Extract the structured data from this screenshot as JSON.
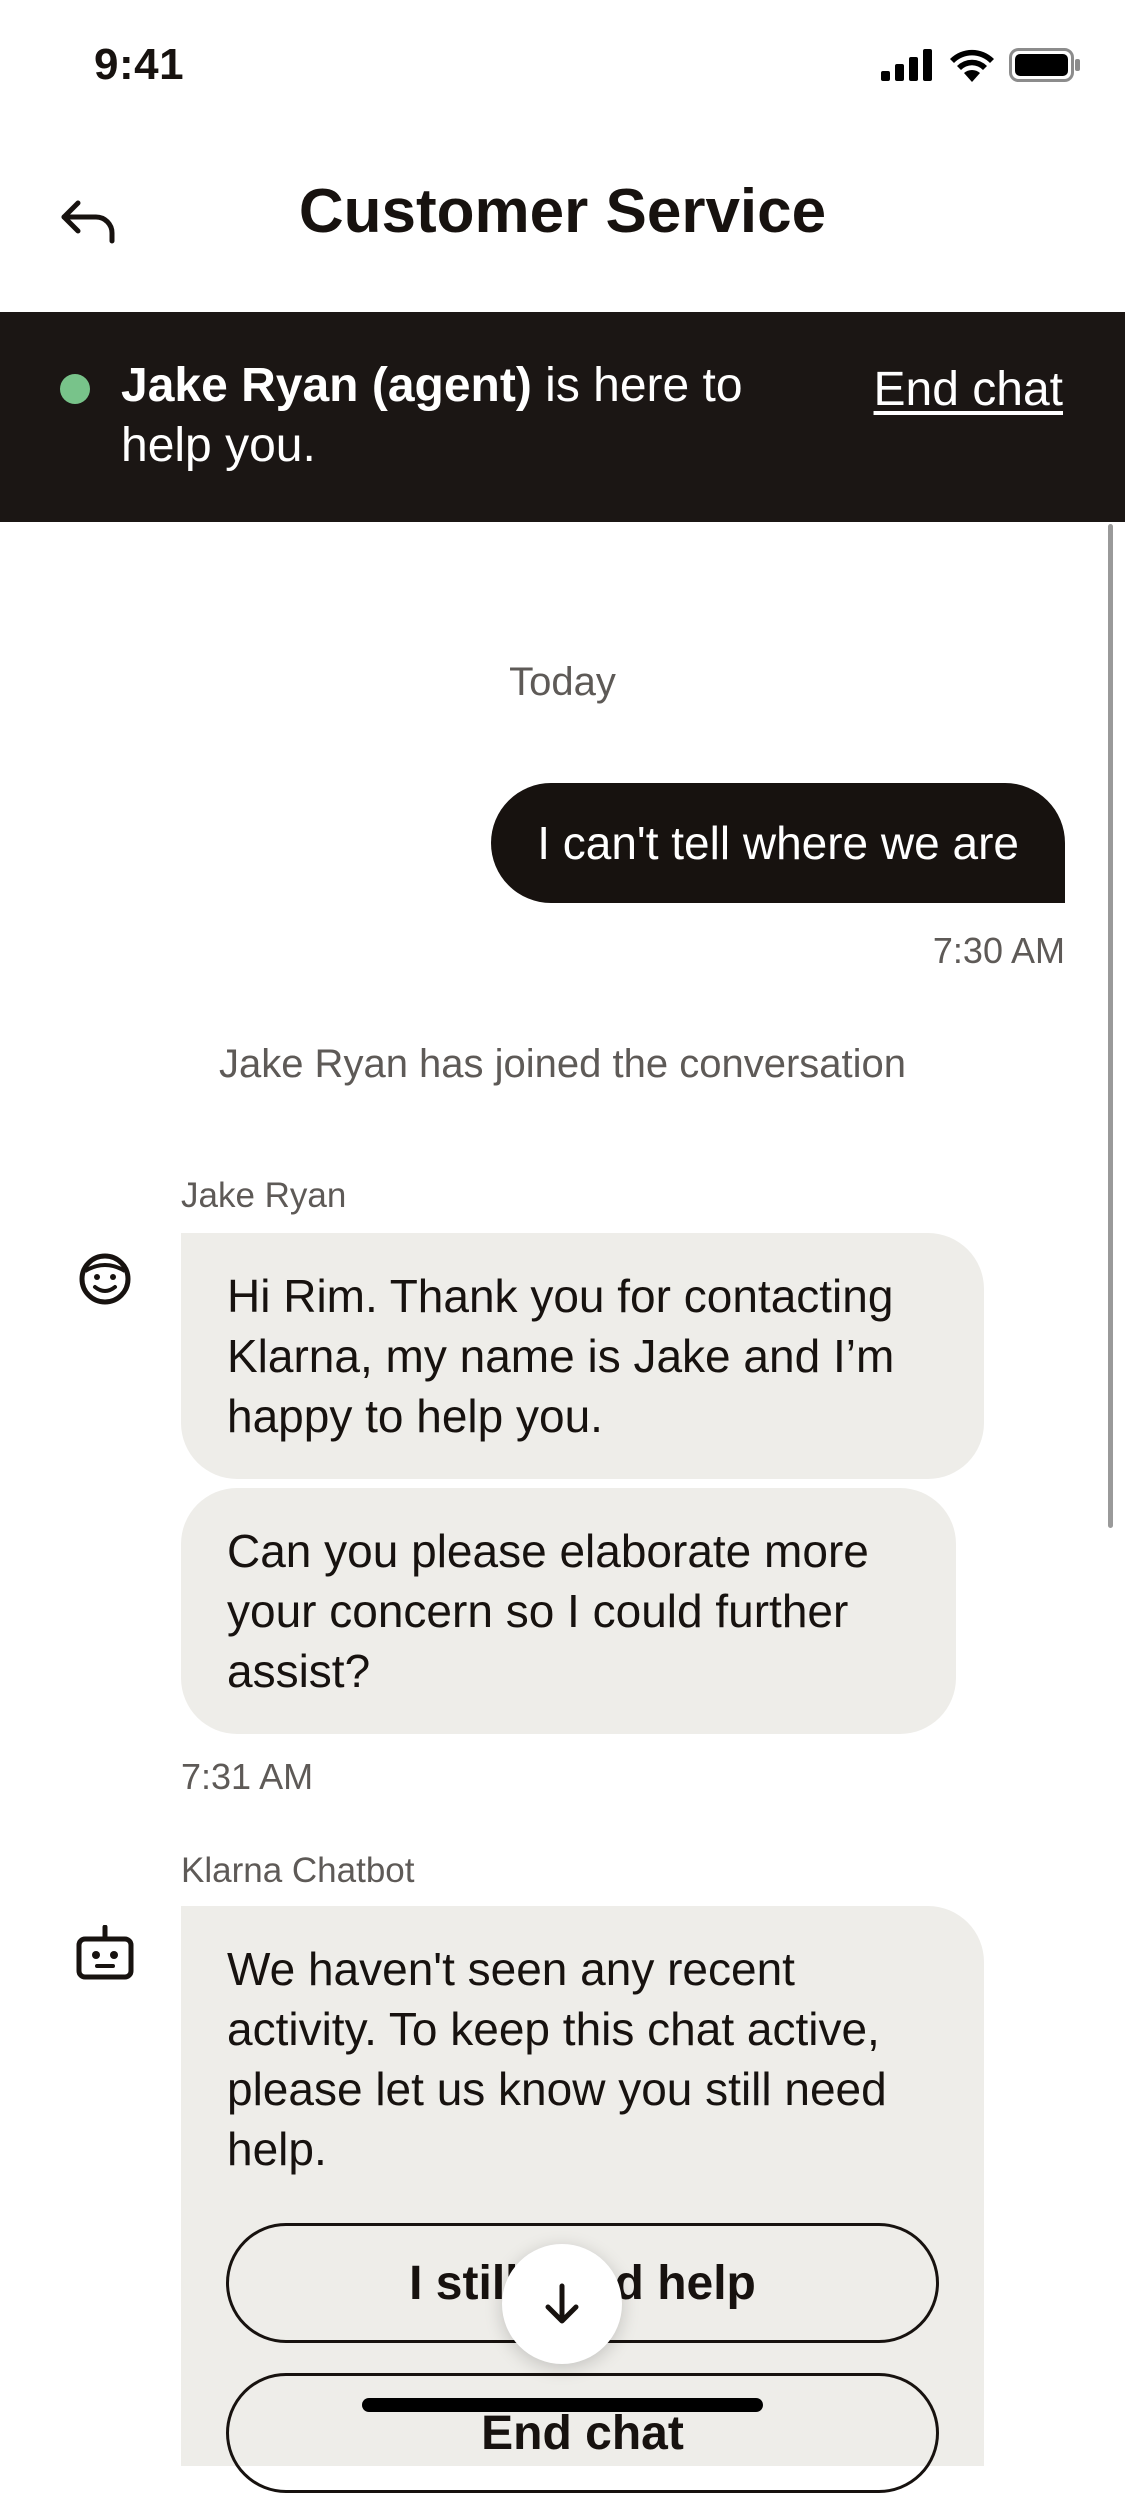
{
  "status_bar": {
    "time": "9:41"
  },
  "header": {
    "title": "Customer Service"
  },
  "banner": {
    "agent_name": "Jake Ryan (agent)",
    "message_rest": " is here to help you.",
    "end_chat_label": "End chat",
    "status_color": "#78c38a"
  },
  "chat": {
    "date_label": "Today",
    "user_message": {
      "text": "I can't tell where we are",
      "time": "7:30 AM"
    },
    "system_notice": "Jake Ryan has joined the conversation",
    "agent": {
      "name": "Jake Ryan",
      "messages": [
        "Hi Rim. Thank you for contacting Klarna, my name is Jake and I’m happy to help you.",
        "Can you please elaborate more your concern so I could further assist?"
      ],
      "time": "7:31 AM"
    },
    "bot": {
      "name": "Klarna Chatbot",
      "message": "We haven't seen any recent activity. To keep this chat active, please let us know you still need help.",
      "options": [
        "I still need help",
        "End chat"
      ]
    }
  },
  "colors": {
    "dark": "#17120f",
    "bubble": "#eeede9",
    "banner": "#1b1614"
  }
}
